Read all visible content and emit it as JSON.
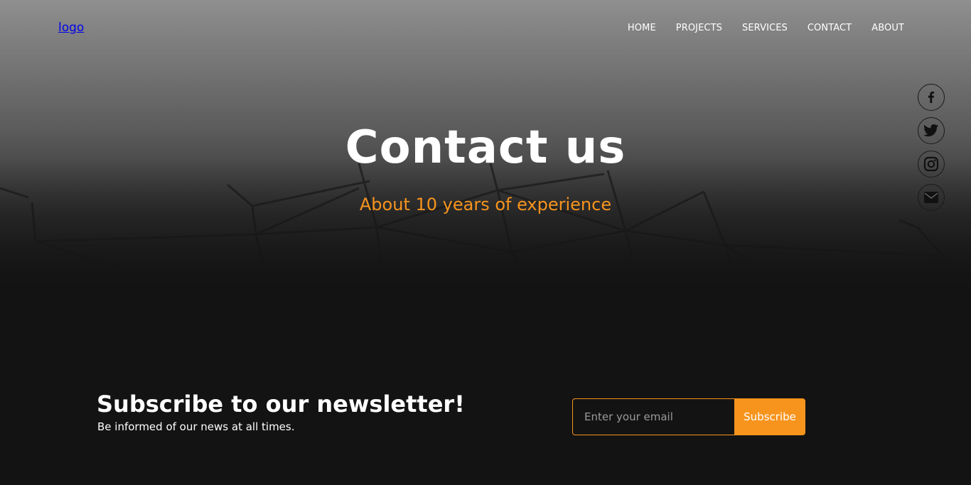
{
  "header": {
    "logo_text": "logo",
    "nav": [
      "HOME",
      "PROJECTS",
      "SERVICES",
      "CONTACT",
      "ABOUT"
    ]
  },
  "socials": [
    "facebook-icon",
    "twitter-icon",
    "instagram-icon",
    "email-icon"
  ],
  "hero": {
    "title": "Contact us",
    "subtitle": "About 10 years of experience"
  },
  "newsletter": {
    "title": "Subscribe to our newsletter!",
    "subtitle": "Be informed of our news at all times.",
    "email_placeholder": "Enter your email",
    "email_value": "",
    "button_label": "Subscribe"
  },
  "colors": {
    "accent": "#f7941d",
    "background": "#131313",
    "link": "#0000ee"
  }
}
